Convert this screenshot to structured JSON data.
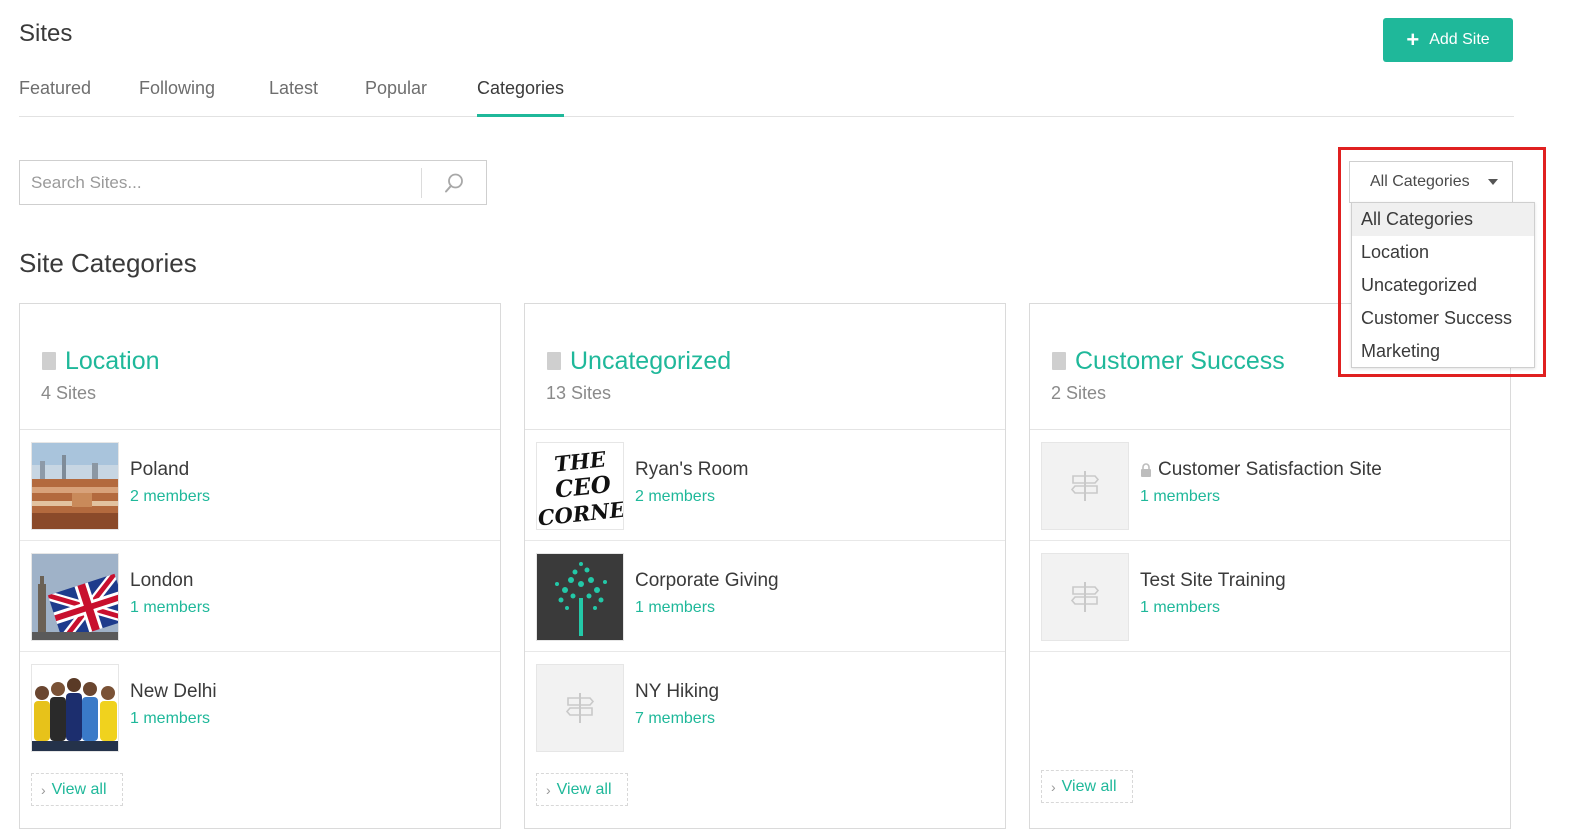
{
  "header": {
    "title": "Sites",
    "add_button_label": "Add Site"
  },
  "tabs": [
    {
      "label": "Featured"
    },
    {
      "label": "Following"
    },
    {
      "label": "Latest"
    },
    {
      "label": "Popular"
    },
    {
      "label": "Categories",
      "active": true
    }
  ],
  "search": {
    "placeholder": "Search Sites..."
  },
  "section_title": "Site Categories",
  "categories": [
    {
      "title": "Location",
      "count": "4 Sites",
      "sites": [
        {
          "name": "Poland",
          "members": "2 members",
          "thumb": "city-photo"
        },
        {
          "name": "London",
          "members": "1 members",
          "thumb": "union-jack-photo"
        },
        {
          "name": "New Delhi",
          "members": "1 members",
          "thumb": "people-photo"
        }
      ],
      "view_all": "View all"
    },
    {
      "title": "Uncategorized",
      "count": "13 Sites",
      "sites": [
        {
          "name": "Ryan's Room",
          "members": "2 members",
          "thumb": "ceo-corner-logo",
          "thumb_text": [
            "THE",
            "CEO",
            "CORNER"
          ]
        },
        {
          "name": "Corporate Giving",
          "members": "1 members",
          "thumb": "tree-photo"
        },
        {
          "name": "NY Hiking",
          "members": "7 members",
          "thumb": "signpost-placeholder"
        }
      ],
      "view_all": "View all"
    },
    {
      "title": "Customer Success",
      "count": "2 Sites",
      "sites": [
        {
          "name": "Customer Satisfaction Site",
          "members": "1 members",
          "thumb": "signpost-placeholder",
          "private": true
        },
        {
          "name": "Test Site Training",
          "members": "1 members",
          "thumb": "signpost-placeholder"
        }
      ],
      "view_all": "View all"
    }
  ],
  "category_filter": {
    "selected": "All Categories",
    "options": [
      "All Categories",
      "Location",
      "Uncategorized",
      "Customer Success",
      "Marketing"
    ]
  },
  "colors": {
    "accent": "#1fb89a",
    "highlight_border": "#e02020"
  }
}
